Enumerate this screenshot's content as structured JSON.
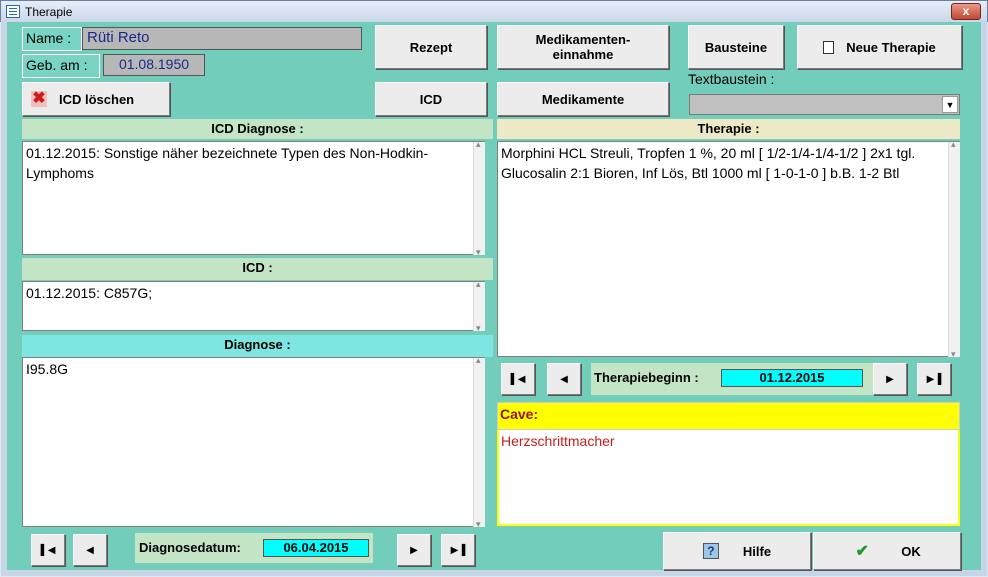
{
  "window": {
    "title": "Therapie",
    "close_label": "x"
  },
  "patient": {
    "name_label": "Name :",
    "name_value": "Rüti Reto",
    "birth_label": "Geb. am :",
    "birth_value": "01.08.1950"
  },
  "buttons": {
    "icd_loeschen": "ICD löschen",
    "rezept": "Rezept",
    "medikamenteneinnahme": "Medikamenten-\neinnahme",
    "bausteine": "Bausteine",
    "neue_therapie": "Neue Therapie",
    "icd": "ICD",
    "medikamente": "Medikamente",
    "hilfe": "Hilfe",
    "ok": "OK"
  },
  "textbaustein": {
    "label": "Textbaustein :",
    "selected": ""
  },
  "icd_diagnose": {
    "header": "ICD Diagnose :",
    "text": "01.12.2015: Sonstige näher bezeichnete Typen des Non-Hodkin-Lymphoms"
  },
  "icd": {
    "header": "ICD :",
    "text": "01.12.2015: C857G;"
  },
  "diagnose": {
    "header": "Diagnose :",
    "text": "I95.8G",
    "date_label": "Diagnosedatum:",
    "date_value": "06.04.2015"
  },
  "therapie": {
    "header": "Therapie :",
    "lines": [
      "Morphini HCL Streuli, Tropfen 1 %, 20 ml [ 1/2-1/4-1/4-1/2 ] 2x1 tgl.",
      "Glucosalin 2:1 Bioren, Inf Lös, Btl 1000 ml [ 1-0-1-0 ] b.B. 1-2 Btl"
    ],
    "beginn_label": "Therapiebeginn :",
    "beginn_value": "01.12.2015"
  },
  "cave": {
    "header": "Cave:",
    "text": "Herzschrittmacher"
  },
  "colors": {
    "background": "#73cdbb",
    "panel_green": "#c4e4c6",
    "panel_cyan": "#7de6e0",
    "panel_beige": "#ede8c6",
    "cave_yellow": "#ffff00",
    "cave_text": "#c0201c",
    "date_cyan": "#00ffff"
  }
}
